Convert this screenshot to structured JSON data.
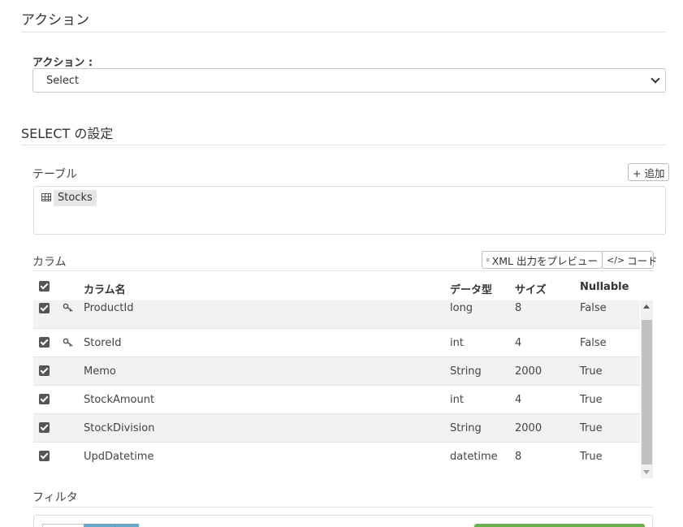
{
  "action_section": {
    "title": "アクション"
  },
  "action_field": {
    "label": "アクション :",
    "selected": "Select"
  },
  "select_section": {
    "title": "SELECT の設定"
  },
  "tables": {
    "label": "テーブル",
    "add_button": "+ 追加",
    "items": [
      {
        "name": "Stocks"
      }
    ]
  },
  "columns": {
    "label": "カラム",
    "preview_button": "XML 出力をプレビュー",
    "code_button": "コード",
    "headers": {
      "name": "カラム名",
      "type": "データ型",
      "size": "サイズ",
      "nullable": "Nullable"
    },
    "rows": [
      {
        "name": "ProductId",
        "type": "long",
        "size": "8",
        "nullable": "False",
        "key": true
      },
      {
        "name": "StoreId",
        "type": "int",
        "size": "4",
        "nullable": "False",
        "key": true
      },
      {
        "name": "Memo",
        "type": "String",
        "size": "2000",
        "nullable": "True",
        "key": false
      },
      {
        "name": "StockAmount",
        "type": "int",
        "size": "4",
        "nullable": "True",
        "key": false
      },
      {
        "name": "StockDivision",
        "type": "String",
        "size": "2000",
        "nullable": "True",
        "key": false
      },
      {
        "name": "UpdDatetime",
        "type": "datetime",
        "size": "8",
        "nullable": "True",
        "key": false
      }
    ]
  },
  "filter": {
    "label": "フィルタ"
  },
  "icons": {
    "key": "key-icon",
    "table": "table-grid-icon",
    "preview": "document-icon",
    "code": "code-icon",
    "check": "checkbox-checked-icon"
  },
  "colors": {
    "checkbox": "#555555",
    "accent_green": "#6ab04c",
    "accent_blue": "#6aa8c8"
  }
}
